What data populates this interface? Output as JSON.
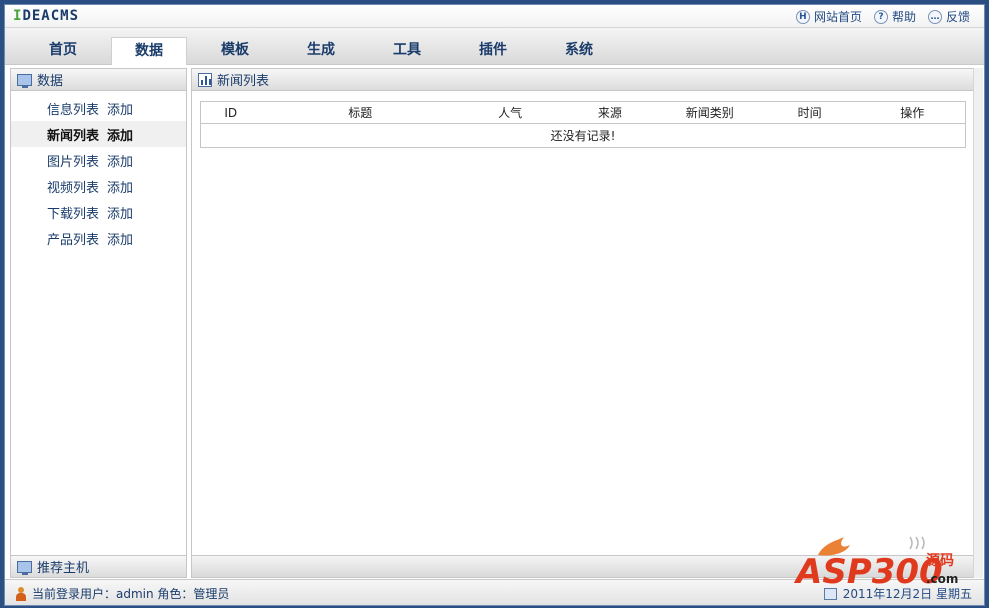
{
  "app": {
    "logo": "IDEACMS",
    "logo_first": "I",
    "logo_rest": "DEACMS"
  },
  "toplinks": [
    {
      "icon": "H",
      "label": "网站首页"
    },
    {
      "icon": "?",
      "label": "帮助"
    },
    {
      "icon": "…",
      "label": "反馈"
    }
  ],
  "tabs": [
    "首页",
    "数据",
    "模板",
    "生成",
    "工具",
    "插件",
    "系统"
  ],
  "active_tab": "数据",
  "sidebar": {
    "title": "数据",
    "items": [
      {
        "label": "信息列表",
        "add": "添加"
      },
      {
        "label": "新闻列表",
        "add": "添加"
      },
      {
        "label": "图片列表",
        "add": "添加"
      },
      {
        "label": "视频列表",
        "add": "添加"
      },
      {
        "label": "下载列表",
        "add": "添加"
      },
      {
        "label": "产品列表",
        "add": "添加"
      }
    ],
    "footer": "推荐主机"
  },
  "main": {
    "title": "新闻列表",
    "columns": [
      "ID",
      "标题",
      "人气",
      "来源",
      "新闻类别",
      "时间",
      "操作"
    ],
    "empty_text": "还没有记录!"
  },
  "status": {
    "user_text": "当前登录用户：admin 角色：管理员",
    "date": "2011年12月2日 星期五"
  },
  "watermark": {
    "brand": "ASP300",
    "suffix": "源码",
    "tld": ".com"
  },
  "colors": {
    "accent": "#1a3c6b",
    "frame": "#2b4f82",
    "watermark": "#e03a1e"
  }
}
